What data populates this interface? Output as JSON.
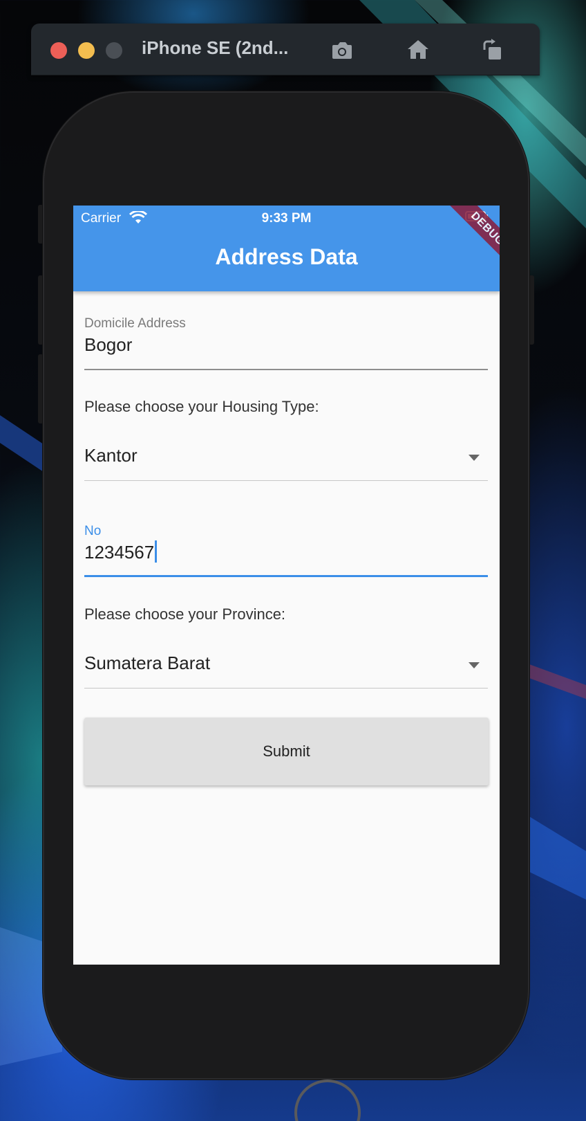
{
  "simulator": {
    "title": "iPhone SE (2nd...",
    "buttons": [
      "screenshot-icon",
      "home-icon",
      "rotate-icon"
    ]
  },
  "status_bar": {
    "carrier": "Carrier",
    "time": "9:33 PM"
  },
  "app_bar": {
    "title": "Address Data",
    "debug_banner": "DEBUG",
    "color": "#4595ea"
  },
  "form": {
    "domicile": {
      "label": "Domicile Address",
      "value": "Bogor"
    },
    "housing_prompt": "Please choose your Housing Type:",
    "housing_type": {
      "selected": "Kantor"
    },
    "number": {
      "label": "No",
      "value": "1234567"
    },
    "province_prompt": "Please choose your Province:",
    "province": {
      "selected": "Sumatera Barat"
    },
    "submit_label": "Submit"
  },
  "colors": {
    "accent": "#3b8ee8",
    "debug": "#8a1d3b",
    "screen_bg": "#fafafa"
  }
}
